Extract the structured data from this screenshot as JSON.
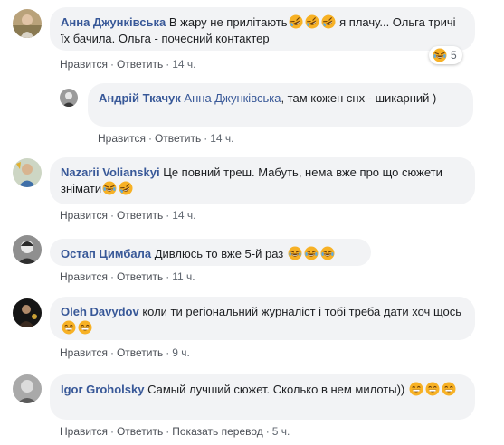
{
  "labels": {
    "like": "Нравится",
    "reply": "Ответить",
    "translate": "Показать перевод"
  },
  "comments": [
    {
      "author": "Анна Джунківська",
      "text_a": "В жару не прилітають",
      "text_b": " я плачу... Ольга тричі їх бачила. Ольга - почесний контактер",
      "time": "14 ч.",
      "reaction_count": "5",
      "avatar_icon": "person-outdoor-avatar"
    },
    {
      "author": "Андрій Ткачук",
      "mention": "Анна Джунківська",
      "text": ", там кожен снх - шикарний )",
      "time": "14 ч.",
      "avatar_icon": "person-avatar"
    },
    {
      "author": "Nazarii Volianskyi",
      "text": " Це повний треш. Мабуть, нема вже про що сюжети знімати",
      "time": "14 ч.",
      "avatar_icon": "person-avatar"
    },
    {
      "author": "Остап Цимбала",
      "text": " Дивлюсь то вже 5-й раз ",
      "time": "11 ч.",
      "avatar_icon": "person-avatar"
    },
    {
      "author": "Oleh Davydov",
      "text": " коли ти регіональний журналіст і тобі треба дати хоч щось",
      "time": "9 ч.",
      "avatar_icon": "person-dark-avatar"
    },
    {
      "author": "Igor Groholsky",
      "text": " Самый лучший сюжет. Сколько в нем милоты)) ",
      "time": "5 ч.",
      "avatar_icon": "person-avatar"
    }
  ],
  "colors": {
    "author": "#385898",
    "bubble": "#f2f3f5",
    "meta": "#606770"
  }
}
